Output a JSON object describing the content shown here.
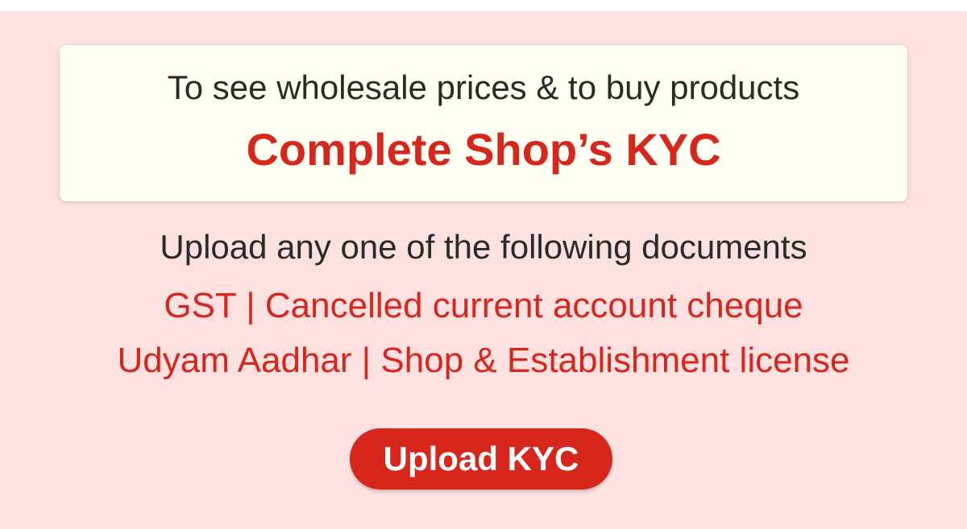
{
  "notice": {
    "line": "To see wholesale prices & to buy products",
    "cta_text": "Complete Shop’s KYC"
  },
  "documents": {
    "intro": "Upload any one of the following documents",
    "line1": "GST | Cancelled current account cheque",
    "line2": "Udyam Aadhar | Shop & Establishment license"
  },
  "actions": {
    "upload_label": "Upload KYC"
  },
  "colors": {
    "background": "#fde1e1",
    "card": "#fffff4",
    "accent": "#d7261b",
    "text": "#2a2a2a"
  }
}
